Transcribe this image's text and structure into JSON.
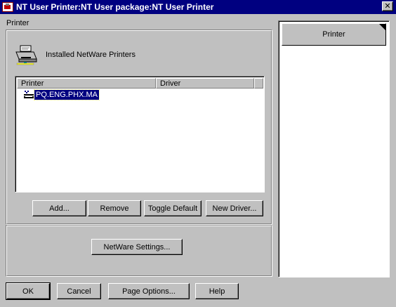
{
  "window": {
    "title": "NT User Printer:NT User package:NT User Printer",
    "close_glyph": "✕"
  },
  "section": {
    "label": "Printer"
  },
  "installed": {
    "label": "Installed NetWare Printers"
  },
  "printer_list": {
    "columns": [
      "Printer",
      "Driver"
    ],
    "rows": [
      {
        "printer": "PQ.ENG.PHX.MA",
        "driver": "",
        "selected": true,
        "icon": "printer-queue-icon"
      }
    ]
  },
  "list_buttons": {
    "add": "Add...",
    "remove": "Remove",
    "toggle_default": "Toggle Default",
    "new_driver": "New Driver..."
  },
  "netware_settings": {
    "label": "NetWare Settings..."
  },
  "footer": {
    "ok": "OK",
    "cancel": "Cancel",
    "page_options": "Page Options...",
    "help": "Help"
  },
  "pages": [
    {
      "label": "Printer",
      "selected": true
    }
  ],
  "icons": {
    "app": "app-icon",
    "close": "close-icon",
    "printer": "printer-icon",
    "queue": "printer-queue-icon"
  },
  "colors": {
    "titlebar": "#000080",
    "face": "#c0c0c0",
    "selection": "#000080"
  }
}
